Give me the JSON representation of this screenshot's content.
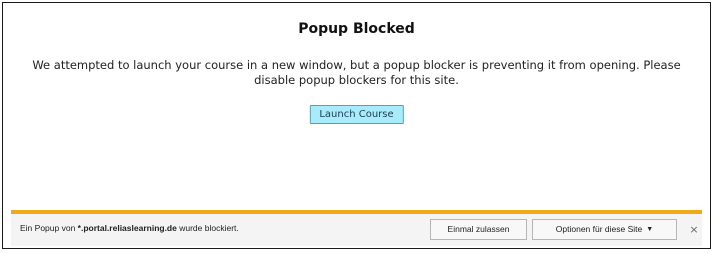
{
  "dialog": {
    "title": "Popup Blocked",
    "message": "We attempted to launch your course in a new window, but a popup blocker is preventing it from opening. Please disable popup blockers for this site.",
    "launch_button": "Launch Course"
  },
  "notification_bar": {
    "text_prefix": "Ein Popup von ",
    "domain": "*.portal.reliaslearning.de",
    "text_suffix": " wurde blockiert.",
    "allow_once_button": "Einmal zulassen",
    "options_button": "Optionen für diese Site",
    "options_caret": "▼",
    "close_glyph": "×"
  },
  "colors": {
    "accent_bar": "#f0aa18",
    "launch_button_bg": "#a8ecfb"
  }
}
